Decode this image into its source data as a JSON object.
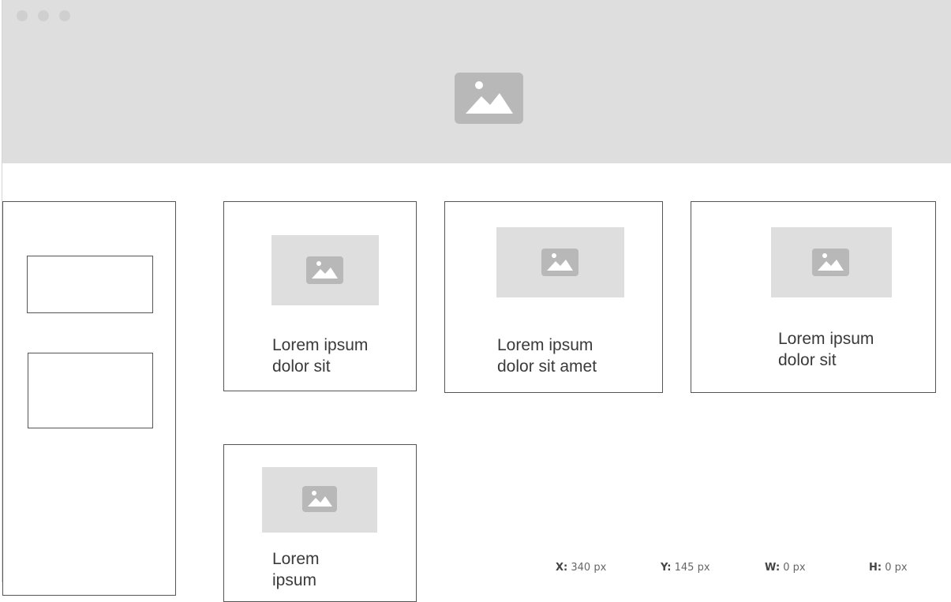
{
  "window": {
    "controls": [
      "close-dot",
      "minimize-dot",
      "maximize-dot"
    ],
    "header_icon": "image-placeholder-icon"
  },
  "sidebar": {
    "boxes": [
      "placeholder-box",
      "placeholder-box"
    ]
  },
  "cards": [
    {
      "caption": "Lorem ipsum\ndolor sit",
      "icon": "image-placeholder-icon"
    },
    {
      "caption": "Lorem ipsum\ndolor sit amet",
      "icon": "image-placeholder-icon"
    },
    {
      "caption": "Lorem ipsum\ndolor sit",
      "icon": "image-placeholder-icon"
    },
    {
      "caption": "Lorem\nipsum",
      "icon": "image-placeholder-icon"
    }
  ],
  "status": {
    "x_label": "X:",
    "x_value": "340 px",
    "y_label": "Y:",
    "y_value": "145 px",
    "w_label": "W:",
    "w_value": "0 px",
    "h_label": "H:",
    "h_value": "0 px"
  },
  "colors": {
    "header_bg": "#dedede",
    "placeholder_bg": "#dedede",
    "placeholder_icon": "#b8b8b8",
    "border": "#555555",
    "text": "#3a3a3a"
  }
}
